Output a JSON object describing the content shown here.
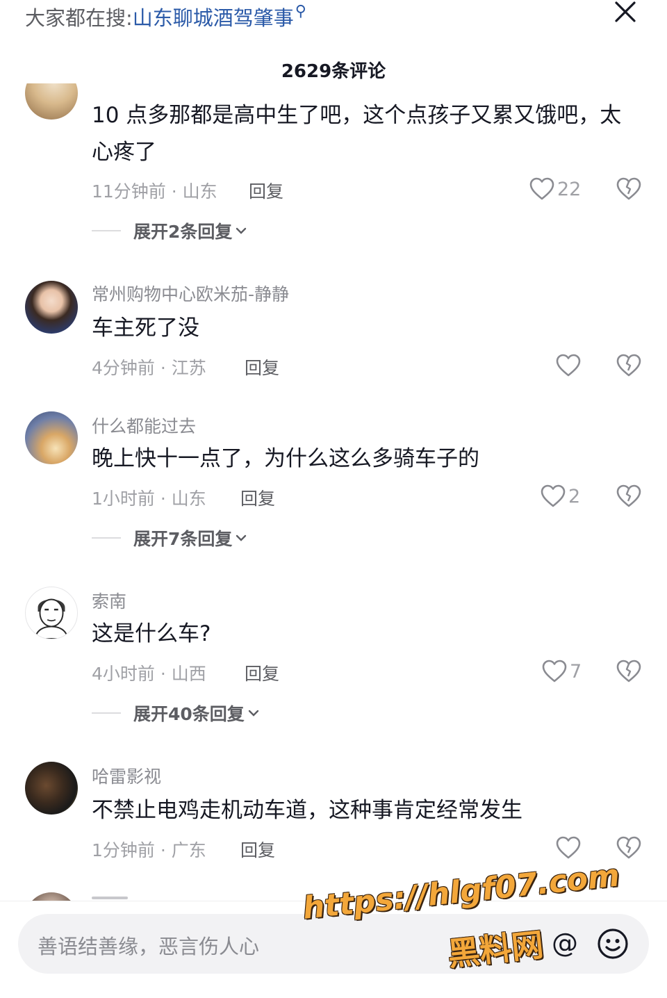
{
  "header": {
    "search_prefix": "大家都在搜:",
    "search_link": "山东聊城酒驾肇事",
    "search_icon": "search-icon",
    "close_icon": "close-icon",
    "comment_count": "2629条评论"
  },
  "comments": [
    {
      "user": "",
      "text": "10 点多那都是高中生了吧，这个点孩子又累又饿吧，太心疼了",
      "meta": "11分钟前 · 山东",
      "reply": "回复",
      "likes": "22",
      "expand": "展开2条回复"
    },
    {
      "user": "常州购物中心欧米茄-静静",
      "text": "车主死了没",
      "meta": "4分钟前 · 江苏",
      "reply": "回复",
      "likes": ""
    },
    {
      "user": "什么都能过去",
      "text": "晚上快十一点了，为什么这么多骑车子的",
      "meta": "1小时前 · 山东",
      "reply": "回复",
      "likes": "2",
      "expand": "展开7条回复"
    },
    {
      "user": "索南",
      "text": "这是什么车?",
      "meta": "4小时前 · 山西",
      "reply": "回复",
      "likes": "7",
      "expand": "展开40条回复"
    },
    {
      "user": "哈雷影视",
      "text": "不禁止电鸡走机动车道，这种事肯定经常发生",
      "meta": "1分钟前 · 广东",
      "reply": "回复",
      "likes": ""
    }
  ],
  "input": {
    "placeholder": "善语结善缘，恶言伤人心",
    "at_symbol": "@",
    "emoji_icon": "smiley-icon"
  },
  "watermark": {
    "url": "https://hlgf07.com",
    "name": "黑料网"
  },
  "colors": {
    "link": "#2b5aa8",
    "text": "#161823",
    "muted": "#9fa0a5",
    "watermark": "#f3a73a"
  }
}
